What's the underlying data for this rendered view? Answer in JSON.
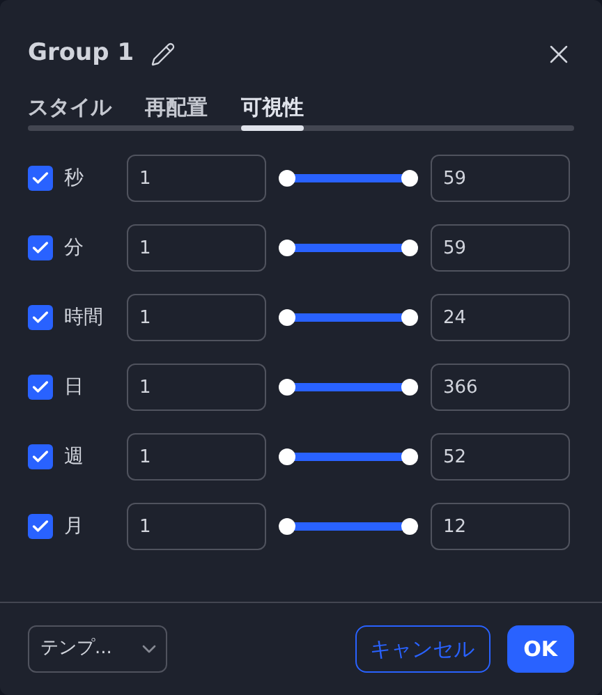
{
  "dialog": {
    "title": "Group 1"
  },
  "tabs": [
    {
      "label": "スタイル",
      "selected": false
    },
    {
      "label": "再配置",
      "selected": false
    },
    {
      "label": "可視性",
      "selected": true
    }
  ],
  "rows": [
    {
      "label": "秒",
      "checked": true,
      "from": "1",
      "to": "59",
      "level": 1
    },
    {
      "label": "分",
      "checked": true,
      "from": "1",
      "to": "59",
      "level": 1
    },
    {
      "label": "時間",
      "checked": true,
      "from": "1",
      "to": "24",
      "level": 1
    },
    {
      "label": "日",
      "checked": true,
      "from": "1",
      "to": "366",
      "level": 1
    },
    {
      "label": "週",
      "checked": true,
      "from": "1",
      "to": "52",
      "level": 1
    },
    {
      "label": "月",
      "checked": true,
      "from": "1",
      "to": "12",
      "level": 1
    }
  ],
  "footer": {
    "template": "テンプ...",
    "cancel": "キャンセル",
    "ok": "OK"
  }
}
